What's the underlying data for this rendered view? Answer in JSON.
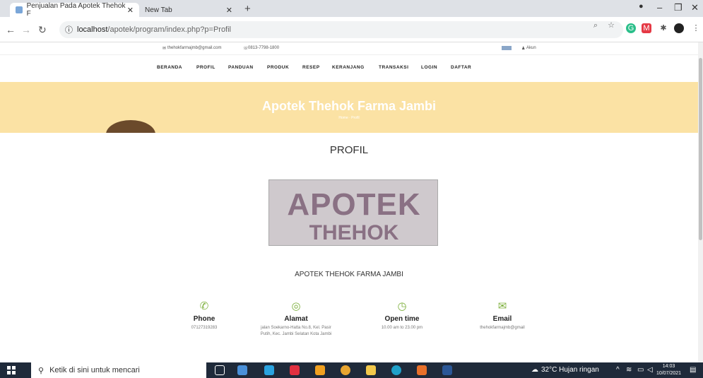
{
  "browser": {
    "tabs": [
      {
        "title": "Penjualan Pada Apotek Thehok F",
        "active": true
      },
      {
        "title": "New Tab",
        "active": false
      }
    ],
    "url_host": "localhost",
    "url_path": "/apotek/program/index.php?p=Profil"
  },
  "site": {
    "email": "thehokfarmajmb@gmail.com",
    "phone": "0813-7798-1800",
    "account": "Akun",
    "nav": [
      "BERANDA",
      "PROFIL",
      "PANDUAN",
      "PRODUK",
      "RESEP",
      "KERANJANG",
      "TRANSAKSI",
      "LOGIN",
      "DAFTAR"
    ],
    "banner_title": "Apotek Thehok Farma Jambi",
    "breadcrumb": "Home  ·  Profil",
    "page_title": "PROFIL",
    "photo_line1": "APOTEK",
    "photo_line2": "THEHOK FARMA",
    "pharmacy_name": "APOTEK THEHOK FARMA JAMBI",
    "contacts": [
      {
        "icon": "phone-icon",
        "label": "Phone",
        "value": "07127319283"
      },
      {
        "icon": "location-icon",
        "label": "Alamat",
        "value": "jalan Soekarno-Hatta No.8, Kel. Pasir Putih, Kec. Jambi Selatan Kota Jambi"
      },
      {
        "icon": "clock-icon",
        "label": "Open time",
        "value": "10.00 am to 23.00 pm"
      },
      {
        "icon": "mail-icon",
        "label": "Email",
        "value": "thehokfarmajmb@gmail"
      }
    ],
    "accent_color": "#7fb13f",
    "banner_color": "#fbe2a4"
  },
  "taskbar": {
    "search_placeholder": "Ketik di sini untuk mencari",
    "weather": "32°C  Hujan ringan",
    "time": "14:03",
    "date": "10/07/2021"
  }
}
